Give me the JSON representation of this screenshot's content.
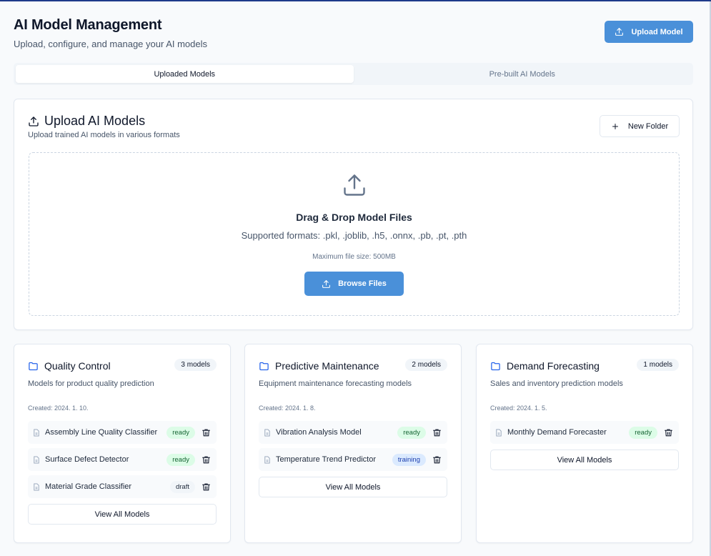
{
  "header": {
    "title": "AI Model Management",
    "subtitle": "Upload, configure, and manage your AI models",
    "upload_button": "Upload Model"
  },
  "tabs": [
    {
      "label": "Uploaded Models",
      "active": true
    },
    {
      "label": "Pre-built AI Models",
      "active": false
    }
  ],
  "upload_card": {
    "title": "Upload AI Models",
    "description": "Upload trained AI models in various formats",
    "new_folder_button": "New Folder",
    "dropzone": {
      "title": "Drag & Drop Model Files",
      "formats": "Supported formats: .pkl, .joblib, .h5, .onnx, .pb, .pt, .pth",
      "max_size": "Maximum file size: 500MB",
      "browse_button": "Browse Files"
    }
  },
  "folders": [
    {
      "name": "Quality Control",
      "count": "3 models",
      "description": "Models for product quality prediction",
      "created": "Created: 2024. 1. 10.",
      "models": [
        {
          "name": "Assembly Line Quality Classifier",
          "status": "ready"
        },
        {
          "name": "Surface Defect Detector",
          "status": "ready"
        },
        {
          "name": "Material Grade Classifier",
          "status": "draft"
        }
      ],
      "view_all": "View All Models"
    },
    {
      "name": "Predictive Maintenance",
      "count": "2 models",
      "description": "Equipment maintenance forecasting models",
      "created": "Created: 2024. 1. 8.",
      "models": [
        {
          "name": "Vibration Analysis Model",
          "status": "ready"
        },
        {
          "name": "Temperature Trend Predictor",
          "status": "training"
        }
      ],
      "view_all": "View All Models"
    },
    {
      "name": "Demand Forecasting",
      "count": "1 models",
      "description": "Sales and inventory prediction models",
      "created": "Created: 2024. 1. 5.",
      "models": [
        {
          "name": "Monthly Demand Forecaster",
          "status": "ready"
        }
      ],
      "view_all": "View All Models"
    }
  ],
  "icons": {
    "upload": "upload-icon",
    "plus": "plus-icon",
    "folder": "folder-icon",
    "file": "file-icon",
    "trash": "trash-icon"
  },
  "colors": {
    "primary": "#4a90d9",
    "folder_icon": "#2563eb",
    "ready_bg": "#dcfce7",
    "ready_text": "#166534",
    "training_bg": "#dbeafe",
    "training_text": "#1e40af",
    "draft_bg": "#f1f5f9"
  }
}
